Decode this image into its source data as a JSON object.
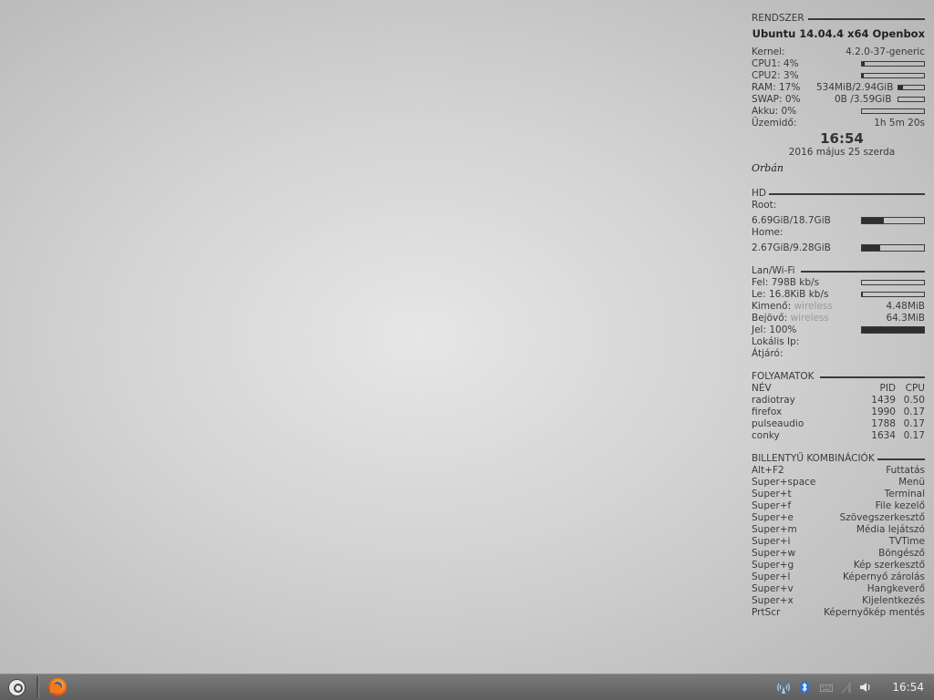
{
  "system": {
    "header": "RENDSZER",
    "title": "Ubuntu 14.04.4 x64 Openbox",
    "kernel_label": "Kernel:",
    "kernel_value": "4.2.0-37-generic",
    "cpu1_label": "CPU1: 4%",
    "cpu1_pct": 4,
    "cpu2_label": "CPU2: 3%",
    "cpu2_pct": 3,
    "ram_label": "RAM: 17%",
    "ram_value": "534MiB/2.94GiB",
    "ram_pct": 17,
    "swap_label": "SWAP: 0%",
    "swap_value": "0B  /3.59GiB",
    "swap_pct": 0,
    "battery_label": "Akku: 0%",
    "battery_pct": 0,
    "uptime_label": "Üzemidő:",
    "uptime_value": "1h 5m 20s",
    "clock": "16:54",
    "date": "2016 május 25 szerda",
    "signature": "Orbán"
  },
  "hd": {
    "header": "HD",
    "root_label": "Root:",
    "root_value": "6.69GiB/18.7GiB",
    "root_pct": 36,
    "home_label": "Home:",
    "home_value": "2.67GiB/9.28GiB",
    "home_pct": 29
  },
  "network": {
    "header": "Lan/Wi-Fi",
    "up_label": "Fel: 798B   kb/s",
    "up_pct": 0,
    "down_label": "Le: 16.8KiB kb/s",
    "down_pct": 2,
    "out_label": "Kimenő:",
    "out_iface": "wireless",
    "out_value": "4.48MiB",
    "in_label": "Bejövő:",
    "in_iface": "wireless",
    "in_value": "64.3MiB",
    "signal_label": "Jel: 100%",
    "signal_pct": 100,
    "local_ip_label": "Lokális Ip:",
    "gateway_label": "Átjáró:"
  },
  "processes": {
    "header": "FOLYAMATOK",
    "col_name": "NÉV",
    "col_pid": "PID",
    "col_cpu": "CPU",
    "rows": [
      {
        "name": "radiotray",
        "pid": "1439",
        "cpu": "0.50"
      },
      {
        "name": "firefox",
        "pid": "1990",
        "cpu": "0.17"
      },
      {
        "name": "pulseaudio",
        "pid": "1788",
        "cpu": "0.17"
      },
      {
        "name": "conky",
        "pid": "1634",
        "cpu": "0.17"
      }
    ]
  },
  "shortcuts": {
    "header": "BILLENTYŰ KOMBINÁCIÓK",
    "rows": [
      {
        "keys": "Alt+F2",
        "action": "Futtatás"
      },
      {
        "keys": "Super+space",
        "action": "Menü"
      },
      {
        "keys": "Super+t",
        "action": "Terminal"
      },
      {
        "keys": "Super+f",
        "action": "File kezelő"
      },
      {
        "keys": "Super+e",
        "action": "Szövegszerkesztő"
      },
      {
        "keys": "Super+m",
        "action": "Média lejátszó"
      },
      {
        "keys": "Super+i",
        "action": "TVTime"
      },
      {
        "keys": "Super+w",
        "action": "Böngésző"
      },
      {
        "keys": "Super+g",
        "action": "Kép szerkesztő"
      },
      {
        "keys": "Super+l",
        "action": "Képernyő zárolás"
      },
      {
        "keys": "Super+v",
        "action": "Hangkeverő"
      },
      {
        "keys": "Super+x",
        "action": "Kijelentkezés"
      },
      {
        "keys": "PrtScr",
        "action": "Képernyőkép mentés"
      }
    ]
  },
  "taskbar": {
    "clock": "16:54",
    "icons": [
      "start-menu-icon",
      "firefox-icon",
      "wifi-icon",
      "bluetooth-icon",
      "keyboard-icon",
      "network-icon",
      "volume-icon"
    ]
  }
}
